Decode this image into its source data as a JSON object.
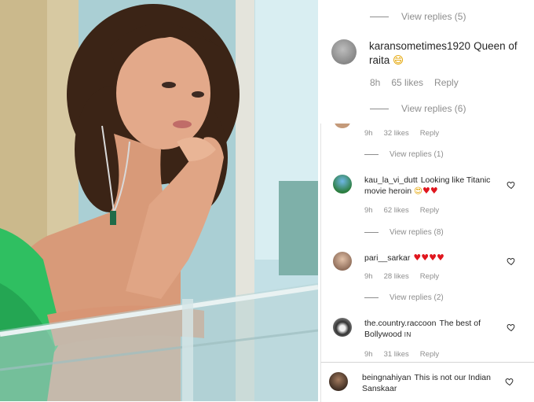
{
  "photo": {
    "description_icon": "photo"
  },
  "top_panel": {
    "view_replies_1": "View replies (5)",
    "comment": {
      "username": "karansometimes1920",
      "text": "Queen of raita",
      "emoji": "😄",
      "time": "8h",
      "likes": "65 likes",
      "reply": "Reply"
    },
    "view_replies_2": "View replies (6)"
  },
  "main_panel": {
    "first_meta": {
      "time": "9h",
      "likes": "32 likes",
      "reply": "Reply"
    },
    "view_replies_a": "View replies (1)",
    "comments": [
      {
        "username": "kau_la_vi_dutt",
        "text": "Looking like Titanic movie heroin",
        "emoji": "😍",
        "hearts": "♥♥",
        "time": "9h",
        "likes": "62 likes",
        "reply": "Reply",
        "view_replies": "View replies (8)"
      },
      {
        "username": "pari__sarkar",
        "text": "",
        "hearts": "♥♥♥♥",
        "time": "9h",
        "likes": "28 likes",
        "reply": "Reply",
        "view_replies": "View replies (2)"
      },
      {
        "username": "the.country.raccoon",
        "text": "The best of Bollywood",
        "suffix": "IN",
        "time": "9h",
        "likes": "31 likes",
        "reply": "Reply"
      }
    ]
  },
  "bottom_panel": {
    "username": "beingnahiyan",
    "text": "This is not our Indian Sanskaar"
  },
  "colors": {
    "heart_red": "#e0161e",
    "meta_gray": "#8e8e8e",
    "text": "#262626"
  }
}
